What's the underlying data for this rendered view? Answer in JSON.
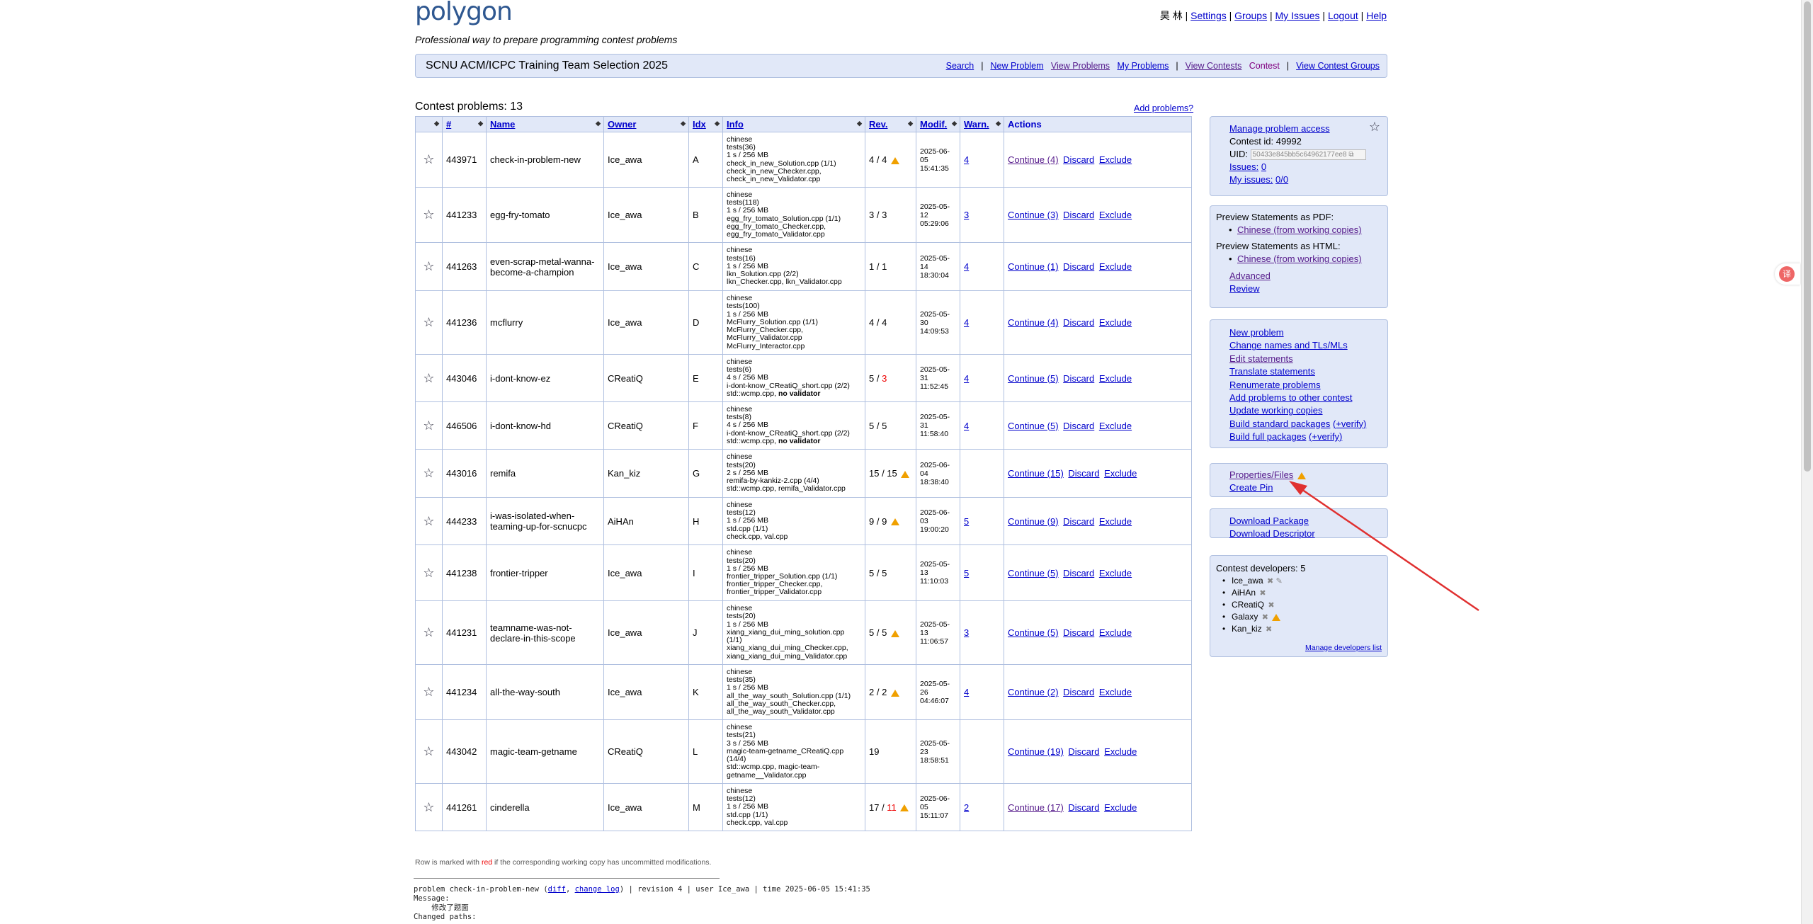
{
  "header": {
    "logo": "polygon",
    "tagline": "Professional way to prepare programming contest problems",
    "user": "昊 林",
    "links": [
      "Settings",
      "Groups",
      "My Issues",
      "Logout",
      "Help"
    ]
  },
  "contest_bar": {
    "name": "SCNU ACM/ICPC Training Team Selection 2025",
    "links": [
      "Search",
      "New Problem",
      "View Problems",
      "My Problems",
      "View Contests",
      "Contest",
      "View Contest Groups"
    ]
  },
  "main": {
    "title": "Contest problems: 13",
    "add_problems": "Add problems?",
    "columns": [
      "#",
      "Name",
      "Owner",
      "Idx",
      "Info",
      "Rev.",
      "Modif.",
      "Warn.",
      "Actions"
    ],
    "rows": [
      {
        "id": "443971",
        "name": "check-in-problem-new",
        "owner": "Ice_awa",
        "idx": "A",
        "info": [
          "chinese",
          "tests(36)",
          "1 s / 256 MB",
          "check_in_new_Solution.cpp (1/1)",
          "check_in_new_Checker.cpp,",
          "check_in_new_Validator.cpp"
        ],
        "rev": "4 / 4",
        "rev_warn": true,
        "rev_red": false,
        "modif": [
          "2025-06-05",
          "15:41:35"
        ],
        "warn": "4",
        "continue": "Continue (4)"
      },
      {
        "id": "441233",
        "name": "egg-fry-tomato",
        "owner": "Ice_awa",
        "idx": "B",
        "info": [
          "chinese",
          "tests(118)",
          "1 s / 256 MB",
          "egg_fry_tomato_Solution.cpp (1/1)",
          "egg_fry_tomato_Checker.cpp,",
          "egg_fry_tomato_Validator.cpp"
        ],
        "rev": "3 / 3",
        "rev_warn": false,
        "rev_red": false,
        "modif": [
          "2025-05-12",
          "05:29:06"
        ],
        "warn": "3",
        "continue": "Continue (3)"
      },
      {
        "id": "441263",
        "name": "even-scrap-metal-wanna-become-a-champion",
        "owner": "Ice_awa",
        "idx": "C",
        "info": [
          "chinese",
          "tests(16)",
          "1 s / 256 MB",
          "lkn_Solution.cpp (2/2)",
          "lkn_Checker.cpp, lkn_Validator.cpp"
        ],
        "rev": "1 / 1",
        "rev_warn": false,
        "rev_red": false,
        "modif": [
          "2025-05-14",
          "18:30:04"
        ],
        "warn": "4",
        "continue": "Continue (1)"
      },
      {
        "id": "441236",
        "name": "mcflurry",
        "owner": "Ice_awa",
        "idx": "D",
        "info": [
          "chinese",
          "tests(100)",
          "1 s / 256 MB",
          "McFlurry_Solution.cpp (1/1)",
          "McFlurry_Checker.cpp,",
          "McFlurry_Validator.cpp",
          "McFlurry_Interactor.cpp"
        ],
        "rev": "4 / 4",
        "rev_warn": false,
        "rev_red": false,
        "modif": [
          "2025-05-30",
          "14:09:53"
        ],
        "warn": "4",
        "continue": "Continue (4)"
      },
      {
        "id": "443046",
        "name": "i-dont-know-ez",
        "owner": "CReatiQ",
        "idx": "E",
        "info": [
          "chinese",
          "tests(6)",
          "4 s / 256 MB",
          "i-dont-know_CReatiQ_short.cpp (2/2)",
          "std::wcmp.cpp, no validator"
        ],
        "rev": "5 / 3",
        "rev_warn": false,
        "rev_red": true,
        "modif": [
          "2025-05-31",
          "11:52:45"
        ],
        "warn": "4",
        "continue": "Continue (5)"
      },
      {
        "id": "446506",
        "name": "i-dont-know-hd",
        "owner": "CReatiQ",
        "idx": "F",
        "info": [
          "chinese",
          "tests(8)",
          "4 s / 256 MB",
          "i-dont-know_CReatiQ_short.cpp (2/2)",
          "std::wcmp.cpp, no validator"
        ],
        "rev": "5 / 5",
        "rev_warn": false,
        "rev_red": false,
        "modif": [
          "2025-05-31",
          "11:58:40"
        ],
        "warn": "4",
        "continue": "Continue (5)"
      },
      {
        "id": "443016",
        "name": "remifa",
        "owner": "Kan_kiz",
        "idx": "G",
        "info": [
          "chinese",
          "tests(20)",
          "2 s / 256 MB",
          "remifa-by-kankiz-2.cpp (4/4)",
          "std::wcmp.cpp, remifa_Validator.cpp"
        ],
        "rev": "15 / 15",
        "rev_warn": true,
        "rev_red": false,
        "modif": [
          "2025-06-04",
          "18:38:40"
        ],
        "warn": "",
        "continue": "Continue (15)"
      },
      {
        "id": "444233",
        "name": "i-was-isolated-when-teaming-up-for-scnucpc",
        "owner": "AiHAn",
        "idx": "H",
        "info": [
          "chinese",
          "tests(12)",
          "1 s / 256 MB",
          "std.cpp (1/1)",
          "check.cpp, val.cpp"
        ],
        "rev": "9 / 9",
        "rev_warn": true,
        "rev_red": false,
        "modif": [
          "2025-06-03",
          "19:00:20"
        ],
        "warn": "5",
        "continue": "Continue (9)"
      },
      {
        "id": "441238",
        "name": "frontier-tripper",
        "owner": "Ice_awa",
        "idx": "I",
        "info": [
          "chinese",
          "tests(20)",
          "1 s / 256 MB",
          "frontier_tripper_Solution.cpp (1/1)",
          "frontier_tripper_Checker.cpp,",
          "frontier_tripper_Validator.cpp"
        ],
        "rev": "5 / 5",
        "rev_warn": false,
        "rev_red": false,
        "modif": [
          "2025-05-13",
          "11:10:03"
        ],
        "warn": "5",
        "continue": "Continue (5)"
      },
      {
        "id": "441231",
        "name": "teamname-was-not-declare-in-this-scope",
        "owner": "Ice_awa",
        "idx": "J",
        "info": [
          "chinese",
          "tests(20)",
          "1 s / 256 MB",
          "xiang_xiang_dui_ming_solution.cpp",
          "(1/1)",
          "xiang_xiang_dui_ming_Checker.cpp,",
          "xiang_xiang_dui_ming_Validator.cpp"
        ],
        "rev": "5 / 5",
        "rev_warn": true,
        "rev_red": false,
        "modif": [
          "2025-05-13",
          "11:06:57"
        ],
        "warn": "3",
        "continue": "Continue (5)"
      },
      {
        "id": "441234",
        "name": "all-the-way-south",
        "owner": "Ice_awa",
        "idx": "K",
        "info": [
          "chinese",
          "tests(35)",
          "1 s / 256 MB",
          "all_the_way_south_Solution.cpp (1/1)",
          "all_the_way_south_Checker.cpp,",
          "all_the_way_south_Validator.cpp"
        ],
        "rev": "2 / 2",
        "rev_warn": true,
        "rev_red": false,
        "modif": [
          "2025-05-26",
          "04:46:07"
        ],
        "warn": "4",
        "continue": "Continue (2)"
      },
      {
        "id": "443042",
        "name": "magic-team-getname",
        "owner": "CReatiQ",
        "idx": "L",
        "info": [
          "chinese",
          "tests(21)",
          "3 s / 256 MB",
          "magic-team-getname_CReatiQ.cpp",
          "(14/4)",
          "std::wcmp.cpp, magic-team-",
          "getname__Validator.cpp"
        ],
        "rev": "19",
        "rev_warn": false,
        "rev_red": false,
        "modif": [
          "2025-05-23",
          "18:58:51"
        ],
        "warn": "",
        "continue": "Continue (19)"
      },
      {
        "id": "441261",
        "name": "cinderella",
        "owner": "Ice_awa",
        "idx": "M",
        "info": [
          "chinese",
          "tests(12)",
          "1 s / 256 MB",
          "std.cpp (1/1)",
          "check.cpp, val.cpp"
        ],
        "rev": "17 / 11",
        "rev_warn": true,
        "rev_red": true,
        "modif": [
          "2025-06-05",
          "15:11:07"
        ],
        "warn": "2",
        "continue": "Continue (17)"
      }
    ],
    "discard": "Discard",
    "exclude": "Exclude"
  },
  "footnote": {
    "pre": "Row is marked with ",
    "red": "red",
    "post": " if the corresponding working copy has uncommitted modifications."
  },
  "log": {
    "line1_pre": "problem check-in-problem-new (",
    "diff": "diff",
    "sep": ", ",
    "change_log": "change log",
    "line1_post": ") | revision 4 | user Ice_awa | time 2025-06-05 15:41:35",
    "line2": "Message:",
    "line3": "    修改了题面",
    "line4": "Changed paths:"
  },
  "sidebar": {
    "box1": {
      "manage": "Manage problem access",
      "contest_id": "Contest id: 49992",
      "uid_label": "UID:",
      "uid_value": "50433e845bb5c64962177ee8",
      "issues_label": "Issues:",
      "issues_value": "0",
      "myissues_label": "My issues:",
      "myissues_value": "0/0"
    },
    "box2": {
      "pdf": "Preview Statements as PDF:",
      "pdf_link": "Chinese (from working copies)",
      "html": "Preview Statements as HTML:",
      "html_link": "Chinese (from working copies)",
      "advanced": "Advanced",
      "review": "Review"
    },
    "box3": [
      "New problem",
      "Change names and TLs/MLs",
      "Edit statements",
      "Translate statements",
      "Renumerate problems",
      "Add problems to other contest",
      "Update working copies",
      "Build standard packages",
      "Build full packages"
    ],
    "verify": "(+verify)",
    "box4": {
      "properties": "Properties/Files",
      "pin": "Create Pin"
    },
    "box5": [
      "Download Package",
      "Download Descriptor"
    ],
    "box6": {
      "title": "Contest developers: 5",
      "devs": [
        "Ice_awa",
        "AiHAn",
        "CReatiQ",
        "Galaxy",
        "Kan_kiz"
      ],
      "manage": "Manage developers list"
    }
  },
  "colors": {
    "accent": "#2e5790",
    "header_bg": "#e1e8f8",
    "border": "#b0c0e0",
    "link": "#0000cc",
    "warning": "#f0a000",
    "annotation_arrow": "#e03030"
  },
  "icons": [
    "star-icon",
    "sort-icon",
    "warning-icon",
    "copy-icon",
    "remove-icon",
    "edit-icon",
    "translate-icon"
  ]
}
